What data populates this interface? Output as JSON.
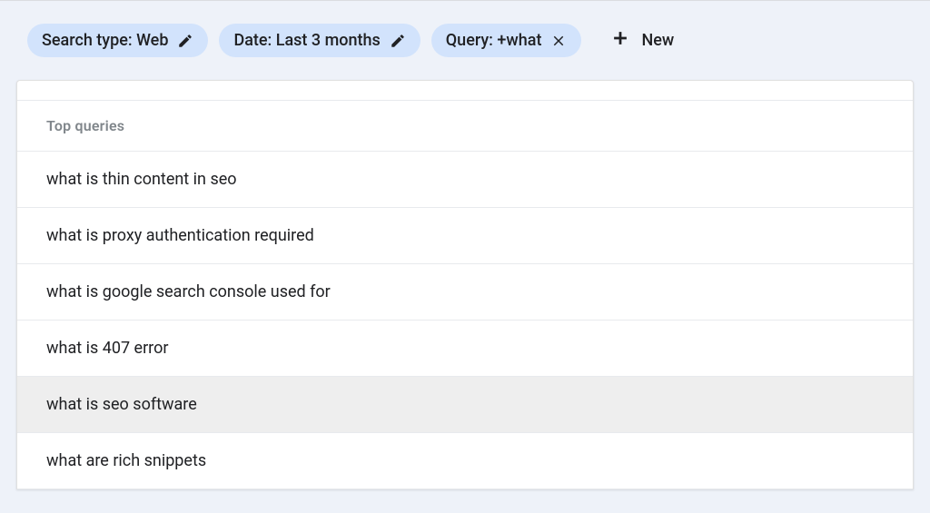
{
  "filters": {
    "search_type": "Search type: Web",
    "date": "Date: Last 3 months",
    "query": "Query: +what",
    "new_label": "New"
  },
  "table": {
    "header": "Top queries",
    "rows": [
      {
        "text": "what is thin content in seo",
        "hover": false
      },
      {
        "text": "what is proxy authentication required",
        "hover": false
      },
      {
        "text": "what is google search console used for",
        "hover": false
      },
      {
        "text": "what is 407 error",
        "hover": false
      },
      {
        "text": "what is seo software",
        "hover": true
      },
      {
        "text": "what are rich snippets",
        "hover": false
      }
    ]
  },
  "colors": {
    "chip_bg": "#d2e3fc",
    "page_bg": "#eef2f9",
    "text": "#202124",
    "muted": "#80868b"
  }
}
